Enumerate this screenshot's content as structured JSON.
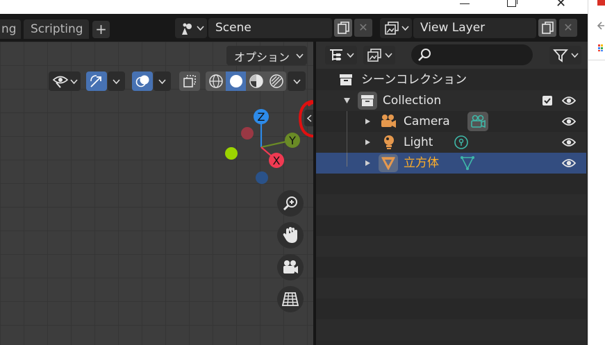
{
  "topbar": {
    "tabs": [
      {
        "label": "ng"
      },
      {
        "label": "Scripting"
      }
    ],
    "add_workspace": "+",
    "scene": {
      "value": "Scene"
    },
    "view_layer": {
      "value": "View Layer"
    }
  },
  "viewport": {
    "options_label": "オプション",
    "gizmo": {
      "z": "Z",
      "y": "Y",
      "x": "X"
    },
    "annotation_colors": {
      "circle": "#e01010"
    }
  },
  "outliner": {
    "scene_collection": "シーンコレクション",
    "items": [
      {
        "name": "Collection",
        "icon": "collection-icon"
      },
      {
        "name": "Camera",
        "icon": "camera-icon"
      },
      {
        "name": "Light",
        "icon": "light-icon"
      },
      {
        "name": "立方体",
        "icon": "mesh-icon"
      }
    ]
  },
  "colors": {
    "selected_row": "#334d80",
    "active_name": "#ffaf29",
    "camera_data": "#3fb8a8",
    "gizmo_x": "#f03a52",
    "gizmo_y": "#6a8b26",
    "gizmo_z": "#2d8bea"
  }
}
